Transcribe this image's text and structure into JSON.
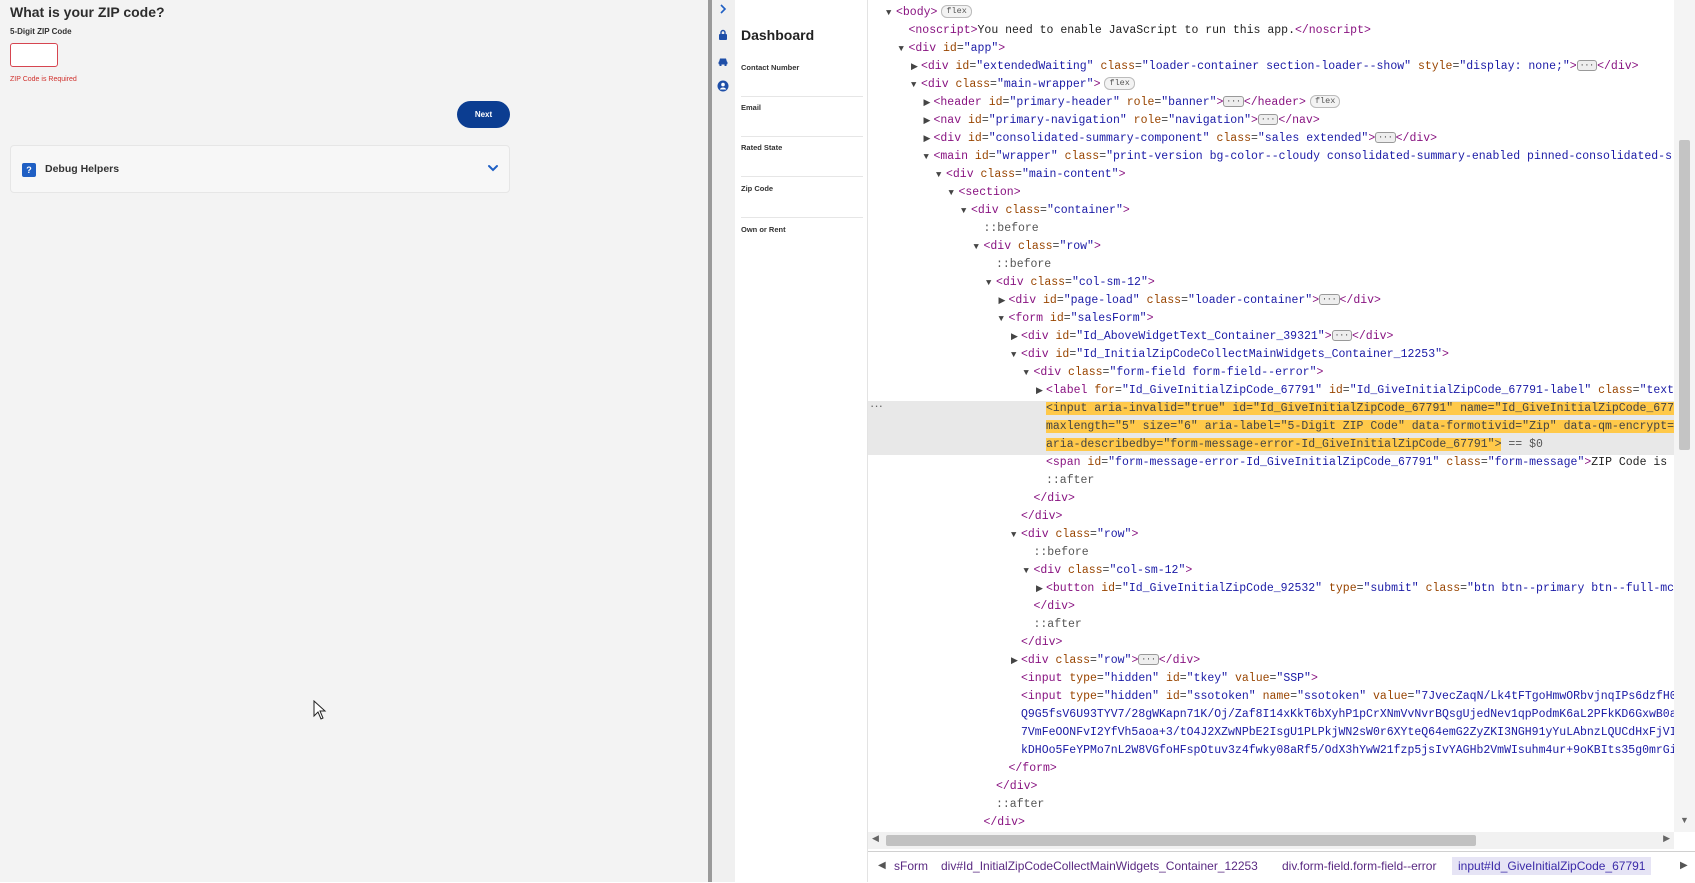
{
  "app": {
    "title": "What is your ZIP code?",
    "zip_label": "5-Digit ZIP Code",
    "zip_value": "",
    "error": "ZIP Code is Required",
    "next_label": "Next",
    "debug_label": "Debug Helpers",
    "debug_icon": "?"
  },
  "sidenav": {
    "icons": [
      "lock-icon",
      "car-icon",
      "user-icon"
    ],
    "dashboard_title": "Dashboard",
    "items": [
      {
        "label": "Contact Number"
      },
      {
        "label": "Email"
      },
      {
        "label": "Rated State"
      },
      {
        "label": "Zip Code"
      },
      {
        "label": "Own or Rent"
      }
    ]
  },
  "devtools": {
    "breadcrumbs": [
      "sForm",
      "div#Id_InitialZipCodeCollectMainWidgets_Container_12253",
      "div.form-field.form-field--error",
      "input#Id_GiveInitialZipCode_67791"
    ],
    "dom_lines": [
      {
        "i": 0,
        "tri": "▼",
        "html": "<span class='t-tag'>&lt;body&gt;</span><span class='badge'>flex</span>"
      },
      {
        "i": 1,
        "tri": "",
        "html": "<span class='t-tag'>&lt;noscript&gt;</span><span class='t-txt'>You need to enable JavaScript to run this app.</span><span class='t-tag'>&lt;/noscript&gt;</span>"
      },
      {
        "i": 1,
        "tri": "▼",
        "html": "<span class='t-tag'>&lt;div </span><span class='t-attr'>id</span>=<span class='t-val'>\"app\"</span><span class='t-tag'>&gt;</span>"
      },
      {
        "i": 2,
        "tri": "▶",
        "html": "<span class='t-tag'>&lt;div </span><span class='t-attr'>id</span>=<span class='t-val'>\"extendedWaiting\"</span> <span class='t-attr'>class</span>=<span class='t-val'>\"loader-container section-loader--show\"</span> <span class='t-attr'>style</span>=<span class='t-val'>\"display: none;\"</span><span class='t-tag'>&gt;</span><span class='ellipsis-badge'>···</span><span class='t-tag'>&lt;/div&gt;</span>"
      },
      {
        "i": 2,
        "tri": "▼",
        "html": "<span class='t-tag'>&lt;div </span><span class='t-attr'>class</span>=<span class='t-val'>\"main-wrapper\"</span><span class='t-tag'>&gt;</span><span class='badge'>flex</span>"
      },
      {
        "i": 3,
        "tri": "▶",
        "html": "<span class='t-tag'>&lt;header </span><span class='t-attr'>id</span>=<span class='t-val'>\"primary-header\"</span> <span class='t-attr'>role</span>=<span class='t-val'>\"banner\"</span><span class='t-tag'>&gt;</span><span class='ellipsis-badge'>···</span><span class='t-tag'>&lt;/header&gt;</span><span class='badge'>flex</span>"
      },
      {
        "i": 3,
        "tri": "▶",
        "html": "<span class='t-tag'>&lt;nav </span><span class='t-attr'>id</span>=<span class='t-val'>\"primary-navigation\"</span> <span class='t-attr'>role</span>=<span class='t-val'>\"navigation\"</span><span class='t-tag'>&gt;</span><span class='ellipsis-badge'>···</span><span class='t-tag'>&lt;/nav&gt;</span>"
      },
      {
        "i": 3,
        "tri": "▶",
        "html": "<span class='t-tag'>&lt;div </span><span class='t-attr'>id</span>=<span class='t-val'>\"consolidated-summary-component\"</span> <span class='t-attr'>class</span>=<span class='t-val'>\"sales extended\"</span><span class='t-tag'>&gt;</span><span class='ellipsis-badge'>···</span><span class='t-tag'>&lt;/div&gt;</span>"
      },
      {
        "i": 3,
        "tri": "▼",
        "html": "<span class='t-tag'>&lt;main </span><span class='t-attr'>id</span>=<span class='t-val'>\"wrapper\"</span> <span class='t-attr'>class</span>=<span class='t-val'>\"print-version bg-color--cloudy consolidated-summary-enabled pinned-consolidated-s</span>"
      },
      {
        "i": 4,
        "tri": "▼",
        "html": "<span class='t-tag'>&lt;div </span><span class='t-attr'>class</span>=<span class='t-val'>\"main-content\"</span><span class='t-tag'>&gt;</span>"
      },
      {
        "i": 5,
        "tri": "▼",
        "html": "<span class='t-tag'>&lt;section&gt;</span>"
      },
      {
        "i": 6,
        "tri": "▼",
        "html": "<span class='t-tag'>&lt;div </span><span class='t-attr'>class</span>=<span class='t-val'>\"container\"</span><span class='t-tag'>&gt;</span>"
      },
      {
        "i": 7,
        "tri": "",
        "html": "<span class='t-pseudo'>::before</span>"
      },
      {
        "i": 7,
        "tri": "▼",
        "html": "<span class='t-tag'>&lt;div </span><span class='t-attr'>class</span>=<span class='t-val'>\"row\"</span><span class='t-tag'>&gt;</span>"
      },
      {
        "i": 8,
        "tri": "",
        "html": "<span class='t-pseudo'>::before</span>"
      },
      {
        "i": 8,
        "tri": "▼",
        "html": "<span class='t-tag'>&lt;div </span><span class='t-attr'>class</span>=<span class='t-val'>\"col-sm-12\"</span><span class='t-tag'>&gt;</span>"
      },
      {
        "i": 9,
        "tri": "▶",
        "html": "<span class='t-tag'>&lt;div </span><span class='t-attr'>id</span>=<span class='t-val'>\"page-load\"</span> <span class='t-attr'>class</span>=<span class='t-val'>\"loader-container\"</span><span class='t-tag'>&gt;</span><span class='ellipsis-badge'>···</span><span class='t-tag'>&lt;/div&gt;</span>"
      },
      {
        "i": 9,
        "tri": "▼",
        "html": "<span class='t-tag'>&lt;form </span><span class='t-attr'>id</span>=<span class='t-val'>\"salesForm\"</span><span class='t-tag'>&gt;</span>"
      },
      {
        "i": 10,
        "tri": "▶",
        "html": "<span class='t-tag'>&lt;div </span><span class='t-attr'>id</span>=<span class='t-val'>\"Id_AboveWidgetText_Container_39321\"</span><span class='t-tag'>&gt;</span><span class='ellipsis-badge'>···</span><span class='t-tag'>&lt;/div&gt;</span>"
      },
      {
        "i": 10,
        "tri": "▼",
        "html": "<span class='t-tag'>&lt;div </span><span class='t-attr'>id</span>=<span class='t-val'>\"Id_InitialZipCodeCollectMainWidgets_Container_12253\"</span><span class='t-tag'>&gt;</span>"
      },
      {
        "i": 11,
        "tri": "▼",
        "html": "<span class='t-tag'>&lt;div </span><span class='t-attr'>class</span>=<span class='t-val'>\"form-field form-field--error\"</span><span class='t-tag'>&gt;</span>"
      },
      {
        "i": 12,
        "tri": "▶",
        "html": "<span class='t-tag'>&lt;label </span><span class='t-attr'>for</span>=<span class='t-val'>\"Id_GiveInitialZipCode_67791\"</span> <span class='t-attr'>id</span>=<span class='t-val'>\"Id_GiveInitialZipCode_67791-label\"</span> <span class='t-attr'>class</span>=<span class='t-val'>\"text</span>"
      },
      {
        "i": 12,
        "tri": "",
        "hl": true,
        "html": "<span class='hl'>&lt;input aria-invalid=\"true\" id=\"Id_GiveInitialZipCode_67791\" name=\"Id_GiveInitialZipCode_677</span>"
      },
      {
        "i": 12,
        "tri": "",
        "hl": true,
        "html": "<span class='hl'>maxlength=\"5\" size=\"6\" aria-label=\"5-Digit ZIP Code\" data-formotivid=\"Zip\" data-qm-encrypt=</span>"
      },
      {
        "i": 12,
        "tri": "",
        "hl": true,
        "html": "<span class='hl'>aria-describedby=\"form-message-error-Id_GiveInitialZipCode_67791\"&gt;</span> <span class='t-pseudo'>== $0</span>"
      },
      {
        "i": 12,
        "tri": "",
        "html": "<span class='t-tag'>&lt;span </span><span class='t-attr'>id</span>=<span class='t-val'>\"form-message-error-Id_GiveInitialZipCode_67791\"</span> <span class='t-attr'>class</span>=<span class='t-val'>\"form-message\"</span><span class='t-tag'>&gt;</span><span class='t-txt'>ZIP Code is</span>"
      },
      {
        "i": 12,
        "tri": "",
        "html": "<span class='t-pseudo'>::after</span>"
      },
      {
        "i": 11,
        "tri": "",
        "html": "<span class='t-tag'>&lt;/div&gt;</span>"
      },
      {
        "i": 10,
        "tri": "",
        "html": "<span class='t-tag'>&lt;/div&gt;</span>"
      },
      {
        "i": 10,
        "tri": "▼",
        "html": "<span class='t-tag'>&lt;div </span><span class='t-attr'>class</span>=<span class='t-val'>\"row\"</span><span class='t-tag'>&gt;</span>"
      },
      {
        "i": 11,
        "tri": "",
        "html": "<span class='t-pseudo'>::before</span>"
      },
      {
        "i": 11,
        "tri": "▼",
        "html": "<span class='t-tag'>&lt;div </span><span class='t-attr'>class</span>=<span class='t-val'>\"col-sm-12\"</span><span class='t-tag'>&gt;</span>"
      },
      {
        "i": 12,
        "tri": "▶",
        "html": "<span class='t-tag'>&lt;button </span><span class='t-attr'>id</span>=<span class='t-val'>\"Id_GiveInitialZipCode_92532\"</span> <span class='t-attr'>type</span>=<span class='t-val'>\"submit\"</span> <span class='t-attr'>class</span>=<span class='t-val'>\"btn btn--primary btn--full-mc</span>"
      },
      {
        "i": 11,
        "tri": "",
        "html": "<span class='t-tag'>&lt;/div&gt;</span>"
      },
      {
        "i": 11,
        "tri": "",
        "html": "<span class='t-pseudo'>::after</span>"
      },
      {
        "i": 10,
        "tri": "",
        "html": "<span class='t-tag'>&lt;/div&gt;</span>"
      },
      {
        "i": 10,
        "tri": "▶",
        "html": "<span class='t-tag'>&lt;div </span><span class='t-attr'>class</span>=<span class='t-val'>\"row\"</span><span class='t-tag'>&gt;</span><span class='ellipsis-badge'>···</span><span class='t-tag'>&lt;/div&gt;</span>"
      },
      {
        "i": 10,
        "tri": "",
        "html": "<span class='t-tag'>&lt;input </span><span class='t-attr'>type</span>=<span class='t-val'>\"hidden\"</span> <span class='t-attr'>id</span>=<span class='t-val'>\"tkey\"</span> <span class='t-attr'>value</span>=<span class='t-val'>\"SSP\"</span><span class='t-tag'>&gt;</span>"
      },
      {
        "i": 10,
        "tri": "",
        "html": "<span class='t-tag'>&lt;input </span><span class='t-attr'>type</span>=<span class='t-val'>\"hidden\"</span> <span class='t-attr'>id</span>=<span class='t-val'>\"ssotoken\"</span> <span class='t-attr'>name</span>=<span class='t-val'>\"ssotoken\"</span> <span class='t-attr'>value</span>=<span class='t-val'>\"7JvecZaqN/Lk4tFTgoHmwORbvjnqIPs6dzfH0</span>"
      },
      {
        "i": 10,
        "tri": "",
        "html": "<span class='t-val'>Q9G5fsV6U93TYV7/28gWKapn71K/Oj/Zaf8I14xKkT6bXyhP1pCrXNmVvNvrBQsgUjedNev1qpPodmK6aL2PFkKD6GxwB0a</span>"
      },
      {
        "i": 10,
        "tri": "",
        "html": "<span class='t-val'>7VmFeOONFvI2YfVh5aoa+3/tO4J2XZwNPbE2IsgU1PLPkjWN2sW0r6XYteQ64emG2ZyZKI3NGH91yYuLAbnzLQUCdHxFjVI</span>"
      },
      {
        "i": 10,
        "tri": "",
        "html": "<span class='t-val'>kDHOo5FeYPMo7nL2W8VGfoHFspOtuv3z4fwky08aRf5/OdX3hYwW21fzp5jsIvYAGHb2VmWIsuhm4ur+9oKBIts35g0mrGi</span>"
      },
      {
        "i": 9,
        "tri": "",
        "html": "<span class='t-tag'>&lt;/form&gt;</span>"
      },
      {
        "i": 8,
        "tri": "",
        "html": "<span class='t-tag'>&lt;/div&gt;</span>"
      },
      {
        "i": 8,
        "tri": "",
        "html": "<span class='t-pseudo'>::after</span>"
      },
      {
        "i": 7,
        "tri": "",
        "html": "<span class='t-tag'>&lt;/div&gt;</span>"
      }
    ]
  }
}
